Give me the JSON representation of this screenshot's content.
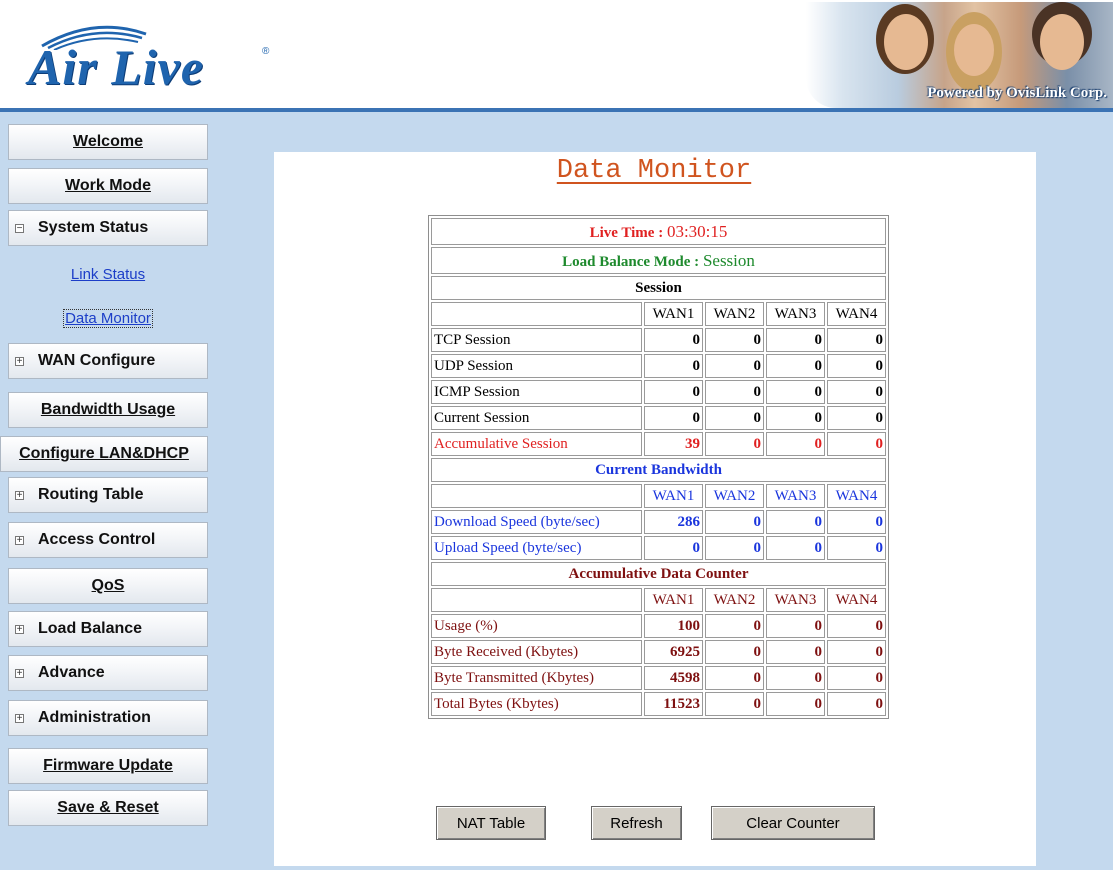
{
  "header": {
    "logo": "Air Live",
    "logo_mark": "®",
    "powered_by": "Powered by OvisLink Corp."
  },
  "sidebar": {
    "items": [
      {
        "label": "Welcome"
      },
      {
        "label": "Work Mode"
      },
      {
        "label": "System Status",
        "expander": "−"
      },
      {
        "label": "WAN Configure",
        "expander": "+"
      },
      {
        "label": "Bandwidth Usage"
      },
      {
        "label": "Configure LAN&DHCP"
      },
      {
        "label": "Routing Table",
        "expander": "+"
      },
      {
        "label": "Access Control",
        "expander": "+"
      },
      {
        "label": "QoS"
      },
      {
        "label": "Load Balance",
        "expander": "+"
      },
      {
        "label": "Advance",
        "expander": "+"
      },
      {
        "label": "Administration",
        "expander": "+"
      },
      {
        "label": "Firmware Update"
      },
      {
        "label": "Save & Reset"
      }
    ],
    "sub_items": [
      {
        "label": "Link Status"
      },
      {
        "label": "Data Monitor",
        "selected": true
      }
    ]
  },
  "main": {
    "title": "Data Monitor",
    "live_time_label": "Live Time :",
    "live_time_value": "03:30:15",
    "lb_mode_label": "Load Balance Mode :",
    "lb_mode_value": "Session",
    "wan_headers": [
      "WAN1",
      "WAN2",
      "WAN3",
      "WAN4"
    ],
    "session": {
      "heading": "Session",
      "rows": [
        {
          "label": "TCP Session",
          "values": [
            "0",
            "0",
            "0",
            "0"
          ]
        },
        {
          "label": "UDP Session",
          "values": [
            "0",
            "0",
            "0",
            "0"
          ]
        },
        {
          "label": "ICMP Session",
          "values": [
            "0",
            "0",
            "0",
            "0"
          ]
        },
        {
          "label": "Current Session",
          "values": [
            "0",
            "0",
            "0",
            "0"
          ]
        },
        {
          "label": "Accumulative Session",
          "values": [
            "39",
            "0",
            "0",
            "0"
          ]
        }
      ]
    },
    "bandwidth": {
      "heading": "Current Bandwidth",
      "rows": [
        {
          "label": "Download Speed (byte/sec)",
          "values": [
            "286",
            "0",
            "0",
            "0"
          ]
        },
        {
          "label": "Upload Speed (byte/sec)",
          "values": [
            "0",
            "0",
            "0",
            "0"
          ]
        }
      ]
    },
    "counter": {
      "heading": "Accumulative Data Counter",
      "rows": [
        {
          "label": "Usage (%)",
          "values": [
            "100",
            "0",
            "0",
            "0"
          ]
        },
        {
          "label": "Byte Received (Kbytes)",
          "values": [
            "6925",
            "0",
            "0",
            "0"
          ]
        },
        {
          "label": "Byte Transmitted (Kbytes)",
          "values": [
            "4598",
            "0",
            "0",
            "0"
          ]
        },
        {
          "label": "Total Bytes (Kbytes)",
          "values": [
            "11523",
            "0",
            "0",
            "0"
          ]
        }
      ]
    },
    "buttons": {
      "nat_table": "NAT Table",
      "refresh": "Refresh",
      "clear_counter": "Clear Counter"
    }
  },
  "colors": {
    "background": "#c4d9ee",
    "title": "#d0541f",
    "live_time": "#e02020",
    "lb_mode": "#1e8a2d",
    "bandwidth": "#1a35dd",
    "counter": "#7e1010"
  }
}
